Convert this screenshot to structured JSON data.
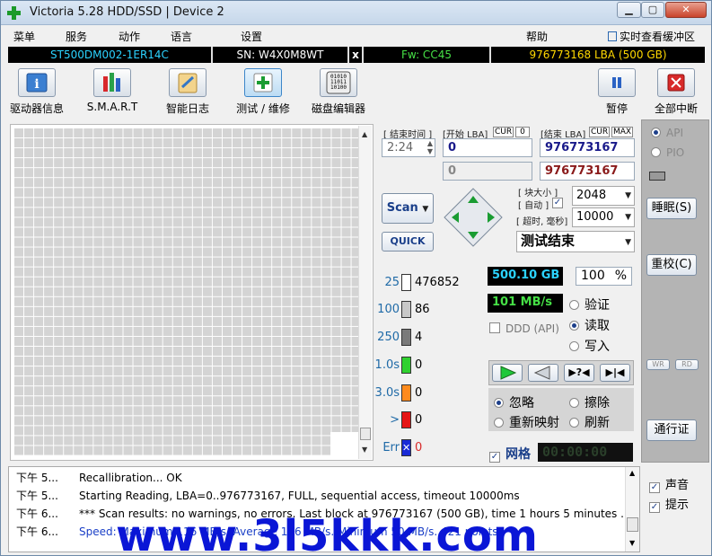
{
  "window": {
    "title": "Victoria 5.28 HDD/SSD | Device 2",
    "min": "▁",
    "max": "▢",
    "close": "✕"
  },
  "menu": {
    "items": [
      "菜单",
      "服务",
      "动作",
      "语言",
      "设置",
      "帮助"
    ],
    "realtime": "实时查看缓冲区"
  },
  "info": {
    "model": "ST500DM002-1ER14C",
    "sn": "SN: W4X0M8WT",
    "x": "x",
    "fw": "Fw: CC45",
    "lba": "976773168 LBA (500 GB)"
  },
  "toolbar": {
    "driver_info": "驱动器信息",
    "smart": "S.M.A.R.T",
    "smart_log": "智能日志",
    "test": "测试 / 维修",
    "disk_editor": "磁盘编辑器",
    "pause": "暂停",
    "abort_all": "全部中断"
  },
  "controls": {
    "end_time_label": "[ 结束时间 ]",
    "end_time": "2:24",
    "start_lba_label": "[开始 LBA]",
    "cur": "CUR",
    "cur_val": "0",
    "end_lba_label": "[结束 LBA]",
    "max": "MAX",
    "start_lba": "0",
    "end_lba": "976773167",
    "start_lba2": "0",
    "end_lba2": "976773167",
    "block_size_label": "[ 块大小 ]",
    "auto_label": "[ 自动 ]",
    "block_size": "2048",
    "timeout_label": "[ 超时, 毫秒]",
    "timeout": "10000",
    "scan": "Scan",
    "quick": "QUICK",
    "status": "测试结束"
  },
  "stats": [
    {
      "k": "25",
      "v": "476852",
      "color": "#ffffff"
    },
    {
      "k": "100",
      "v": "86",
      "color": "#c8c8c8"
    },
    {
      "k": "250",
      "v": "4",
      "color": "#7a7a7a"
    },
    {
      "k": "1.0s",
      "v": "0",
      "color": "#2fd12f"
    },
    {
      "k": "3.0s",
      "v": "0",
      "color": "#ff8a1c"
    },
    {
      "k": ">",
      "v": "0",
      "color": "#e51515"
    },
    {
      "k": "Err",
      "v": "0",
      "color": "#1a2bd6"
    }
  ],
  "progress": {
    "size": "500.10 GB",
    "percent": "100",
    "pct_sign": "%",
    "speed": "101 MB/s"
  },
  "modes": {
    "verify": "验证",
    "read": "读取",
    "write": "写入",
    "ddd": "DDD (API)"
  },
  "actions": {
    "ignore": "忽略",
    "erase": "擦除",
    "remap": "重新映射",
    "refresh": "刷新"
  },
  "grid_label": "网格",
  "timer": "00:00:00",
  "side": {
    "api": "API",
    "pio": "PIO",
    "sleep": "睡眠(S)",
    "recal": "重校(C)",
    "wr": "WR",
    "rd": "RD",
    "passport": "通行证"
  },
  "log": [
    {
      "t": "下午 5...",
      "m": "Recallibration... OK"
    },
    {
      "t": "下午 5...",
      "m": "Starting Reading, LBA=0..976773167, FULL, sequential access, timeout 10000ms"
    },
    {
      "t": "下午 6...",
      "m": "*** Scan results: no warnings, no errors. Last block at 976773167 (500 GB), time 1 hours 5 minutes ..."
    },
    {
      "t": "下午 6...",
      "m": "Speed: Maximum 116 MB/s. Average 116 MB/s. Minimum 50 MB/s. 421 points."
    }
  ],
  "log_checks": {
    "sound": "声音",
    "hints": "提示"
  },
  "watermark": "www.3l5kkk.com"
}
